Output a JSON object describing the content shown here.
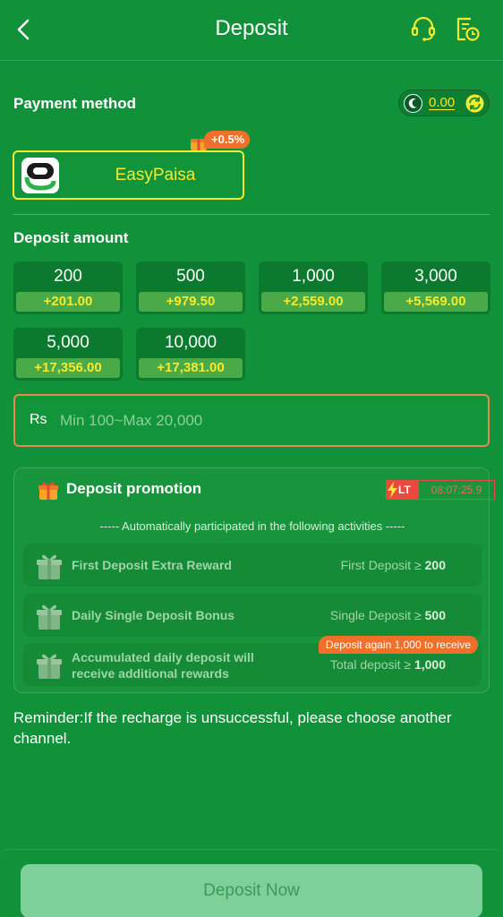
{
  "header": {
    "title": "Deposit"
  },
  "payment": {
    "section_title": "Payment method",
    "balance": "0.00",
    "method_label": "EasyPaisa",
    "bonus_badge": "+0.5%"
  },
  "deposit": {
    "section_title": "Deposit amount",
    "amounts": [
      {
        "value": "200",
        "bonus": "+201.00"
      },
      {
        "value": "500",
        "bonus": "+979.50"
      },
      {
        "value": "1,000",
        "bonus": "+2,559.00"
      },
      {
        "value": "3,000",
        "bonus": "+5,569.00"
      },
      {
        "value": "5,000",
        "bonus": "+17,356.00"
      },
      {
        "value": "10,000",
        "bonus": "+17,381.00"
      }
    ],
    "currency": "Rs",
    "placeholder": "Min 100~Max 20,000"
  },
  "promotion": {
    "title": "Deposit promotion",
    "lt_tag": "LT",
    "countdown": "08:07:25.9",
    "subtitle": "----- Automatically participated in the following activities -----",
    "items": [
      {
        "name": "First Deposit Extra Reward",
        "cond_text": "First Deposit ≥ ",
        "cond_value": "200"
      },
      {
        "name": "Daily Single Deposit Bonus",
        "cond_text": "Single Deposit ≥ ",
        "cond_value": "500"
      },
      {
        "name": "Accumulated daily deposit will receive additional rewards",
        "cond_text": "Total deposit ≥ ",
        "cond_value": "1,000",
        "tip": "Deposit again 1,000 to receive"
      }
    ]
  },
  "reminder": "Reminder:If the recharge is unsuccessful, please choose another channel.",
  "footer": {
    "button_label": "Deposit Now"
  },
  "colors": {
    "background": "#11923a",
    "accent_yellow": "#f5ea2b",
    "badge_orange": "#f0702a",
    "button": "#7ed09a"
  }
}
